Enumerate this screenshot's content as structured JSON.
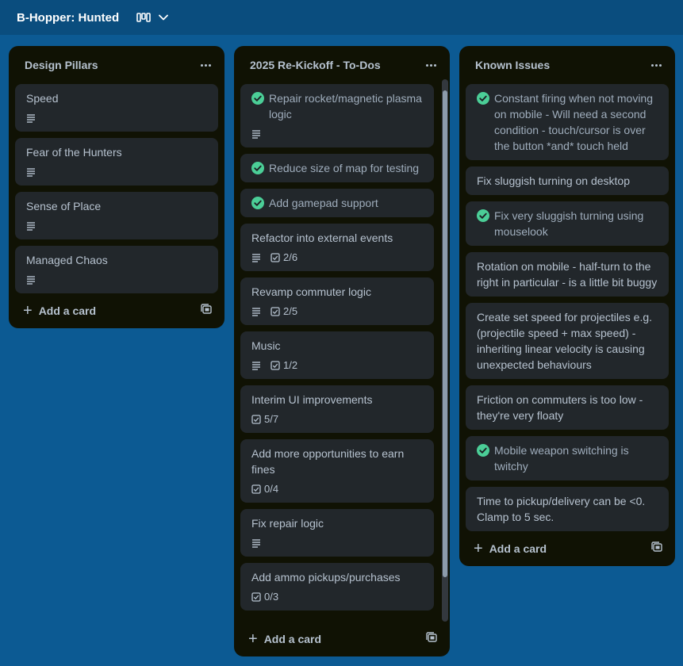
{
  "board": {
    "title": "B-Hopper: Hunted",
    "view_icon": "board-view-icon",
    "chevron_icon": "chevron-down-icon"
  },
  "colors": {
    "background": "#0c5a93",
    "list": "#101204",
    "card": "#22272b",
    "complete": "#4bce97"
  },
  "lists": [
    {
      "title": "Design Pillars",
      "add_label": "Add a card",
      "cards": [
        {
          "title": "Speed",
          "description": true
        },
        {
          "title": "Fear of the Hunters",
          "description": true
        },
        {
          "title": "Sense of Place",
          "description": true
        },
        {
          "title": "Managed Chaos",
          "description": true
        }
      ]
    },
    {
      "title": "2025 Re-Kickoff - To-Dos",
      "add_label": "Add a card",
      "cards": [
        {
          "title": "Repair rocket/magnetic plasma logic",
          "complete": true,
          "description": true
        },
        {
          "title": "Reduce size of map for testing",
          "complete": true
        },
        {
          "title": "Add gamepad support",
          "complete": true
        },
        {
          "title": "Refactor into external events",
          "description": true,
          "checklist": "2/6"
        },
        {
          "title": "Revamp commuter logic",
          "description": true,
          "checklist": "2/5"
        },
        {
          "title": "Music",
          "description": true,
          "checklist": "1/2"
        },
        {
          "title": "Interim UI improvements",
          "checklist": "5/7"
        },
        {
          "title": "Add more opportunities to earn fines",
          "checklist": "0/4"
        },
        {
          "title": "Fix repair logic",
          "description": true
        },
        {
          "title": "Add ammo pickups/purchases",
          "checklist": "0/3"
        }
      ]
    },
    {
      "title": "Known Issues",
      "add_label": "Add a card",
      "cards": [
        {
          "title": "Constant firing when not moving on mobile - Will need a second condition - touch/cursor is over the button *and* touch held",
          "complete": true
        },
        {
          "title": "Fix sluggish turning on desktop"
        },
        {
          "title": "Fix very sluggish turning using mouselook",
          "complete": true
        },
        {
          "title": "Rotation on mobile - half-turn to the right in particular - is a little bit buggy"
        },
        {
          "title": "Create set speed for projectiles e.g. (projectile speed + max speed) - inheriting linear velocity is causing unexpected behaviours"
        },
        {
          "title": "Friction on commuters is too low - they're very floaty"
        },
        {
          "title": "Mobile weapon switching is twitchy",
          "complete": true
        },
        {
          "title": "Time to pickup/delivery can be <0. Clamp to 5 sec."
        }
      ]
    }
  ]
}
